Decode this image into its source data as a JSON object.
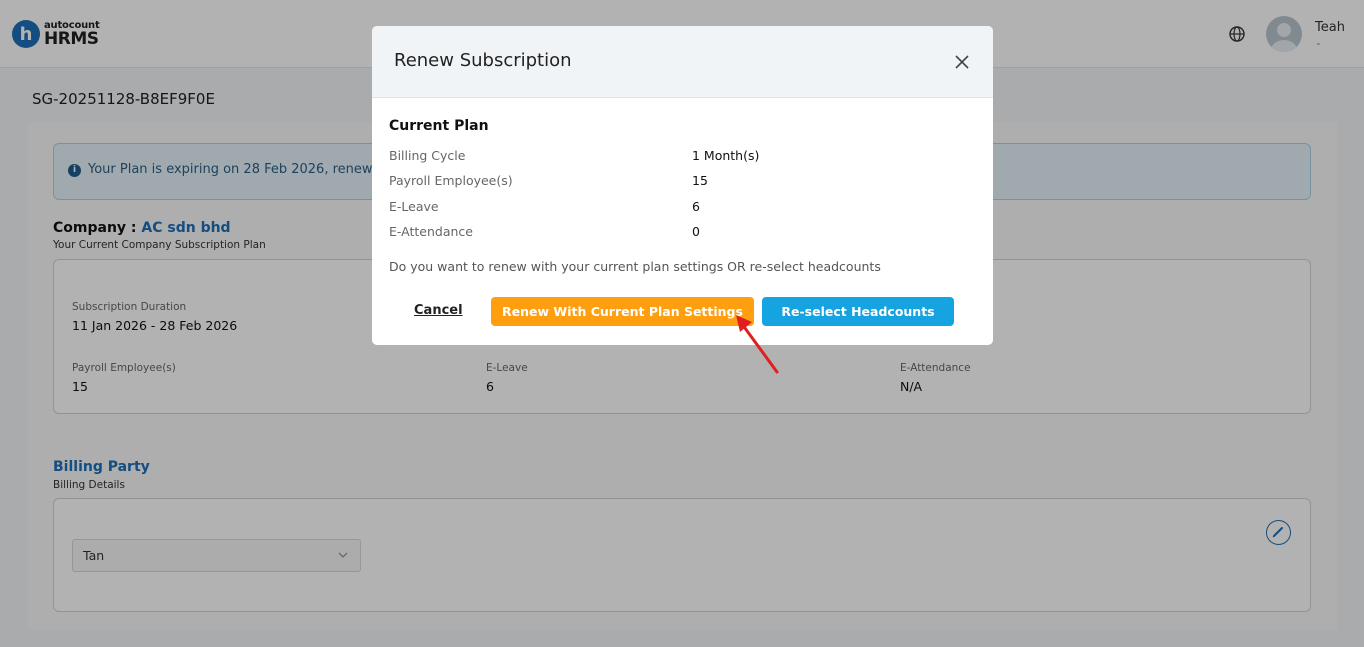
{
  "header": {
    "logo_small": "autocount",
    "logo_big": "HRMS",
    "logo_letter": "h",
    "user_name": "Teah",
    "user_caret": "⌄"
  },
  "page": {
    "subscription_id": "SG-20251128-B8EF9F0E",
    "alert_text": "Your Plan is expiring on 28 Feb 2026, renew now",
    "company_label": "Company :",
    "company_name": "AC sdn bhd",
    "company_sub": "Your Current Company Subscription Plan",
    "plan": {
      "duration_label": "Subscription Duration",
      "duration_value": "11 Jan 2026 - 28 Feb 2026",
      "payroll_label": "Payroll Employee(s)",
      "payroll_value": "15",
      "eleave_label": "E-Leave",
      "eleave_value": "6",
      "eattendance_label": "E-Attendance",
      "eattendance_value": "N/A"
    },
    "billing_title": "Billing Party",
    "billing_sub": "Billing Details",
    "billing_select_value": "Tan"
  },
  "modal": {
    "title": "Renew Subscription",
    "section_title": "Current Plan",
    "rows": [
      {
        "label": "Billing Cycle",
        "value": "1 Month(s)"
      },
      {
        "label": "Payroll Employee(s)",
        "value": "15"
      },
      {
        "label": "E-Leave",
        "value": "6"
      },
      {
        "label": "E-Attendance",
        "value": "0"
      }
    ],
    "question": "Do you want to renew with your current plan settings OR re-select headcounts",
    "cancel_label": "Cancel",
    "renew_label": "Renew With Current Plan Settings",
    "reselect_label": "Re-select Headcounts"
  },
  "colors": {
    "brand_blue": "#1e6fb9",
    "renew_orange": "#ff9f10",
    "reselect_blue": "#15a3e2",
    "arrow_red": "#e02020"
  },
  "icons": {
    "globe": "globe-icon",
    "close": "close-icon",
    "info": "info-icon",
    "chevron": "chevron-down-icon",
    "edit": "pencil-icon"
  }
}
